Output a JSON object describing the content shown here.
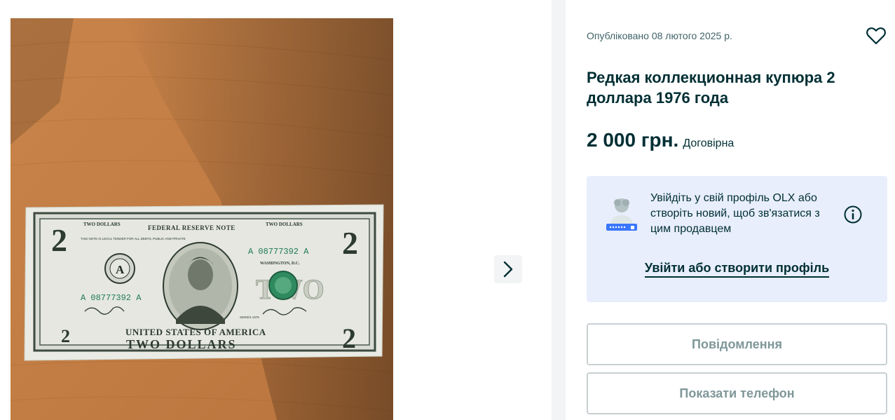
{
  "listing": {
    "posted": "Опубліковано 08 лютого 2025 р.",
    "title": "Редкая коллекционная купюра 2 доллара 1976 года",
    "price": "2 000 грн.",
    "negotiable": "Договірна"
  },
  "banknote": {
    "serial": "A 08777392 A",
    "top_left_label": "TWO DOLLARS",
    "top_center_label": "FEDERAL RESERVE NOTE",
    "top_right_label": "TWO DOLLARS",
    "legal_tender": "THIS NOTE IS LEGAL TENDER FOR ALL DEBTS, PUBLIC AND PRIVATE",
    "bank_letter": "A",
    "city": "WASHINGTON, D.C.",
    "denomination_numeral": "2",
    "country": "UNITED STATES OF AMERICA",
    "bottom_label": "TWO DOLLARS",
    "series": "SERIES 1976"
  },
  "login_prompt": {
    "text": "Увійдіть у свій профіль OLX або створіть новий, щоб зв'язатися з цим продавцем",
    "link": "Увійти або створити профіль"
  },
  "buttons": {
    "message": "Повідомлення",
    "phone": "Показати телефон"
  },
  "icons": {
    "favorite": "heart-outline-icon",
    "next": "chevron-right-icon",
    "info": "info-circle-icon",
    "login": "user-password-illustration"
  },
  "colors": {
    "text": "#002f34",
    "muted": "#406367",
    "login_box": "#e8eefc",
    "gutter": "#f2f4f5",
    "button_border": "#c8d0d2",
    "button_text": "#7f9799"
  }
}
